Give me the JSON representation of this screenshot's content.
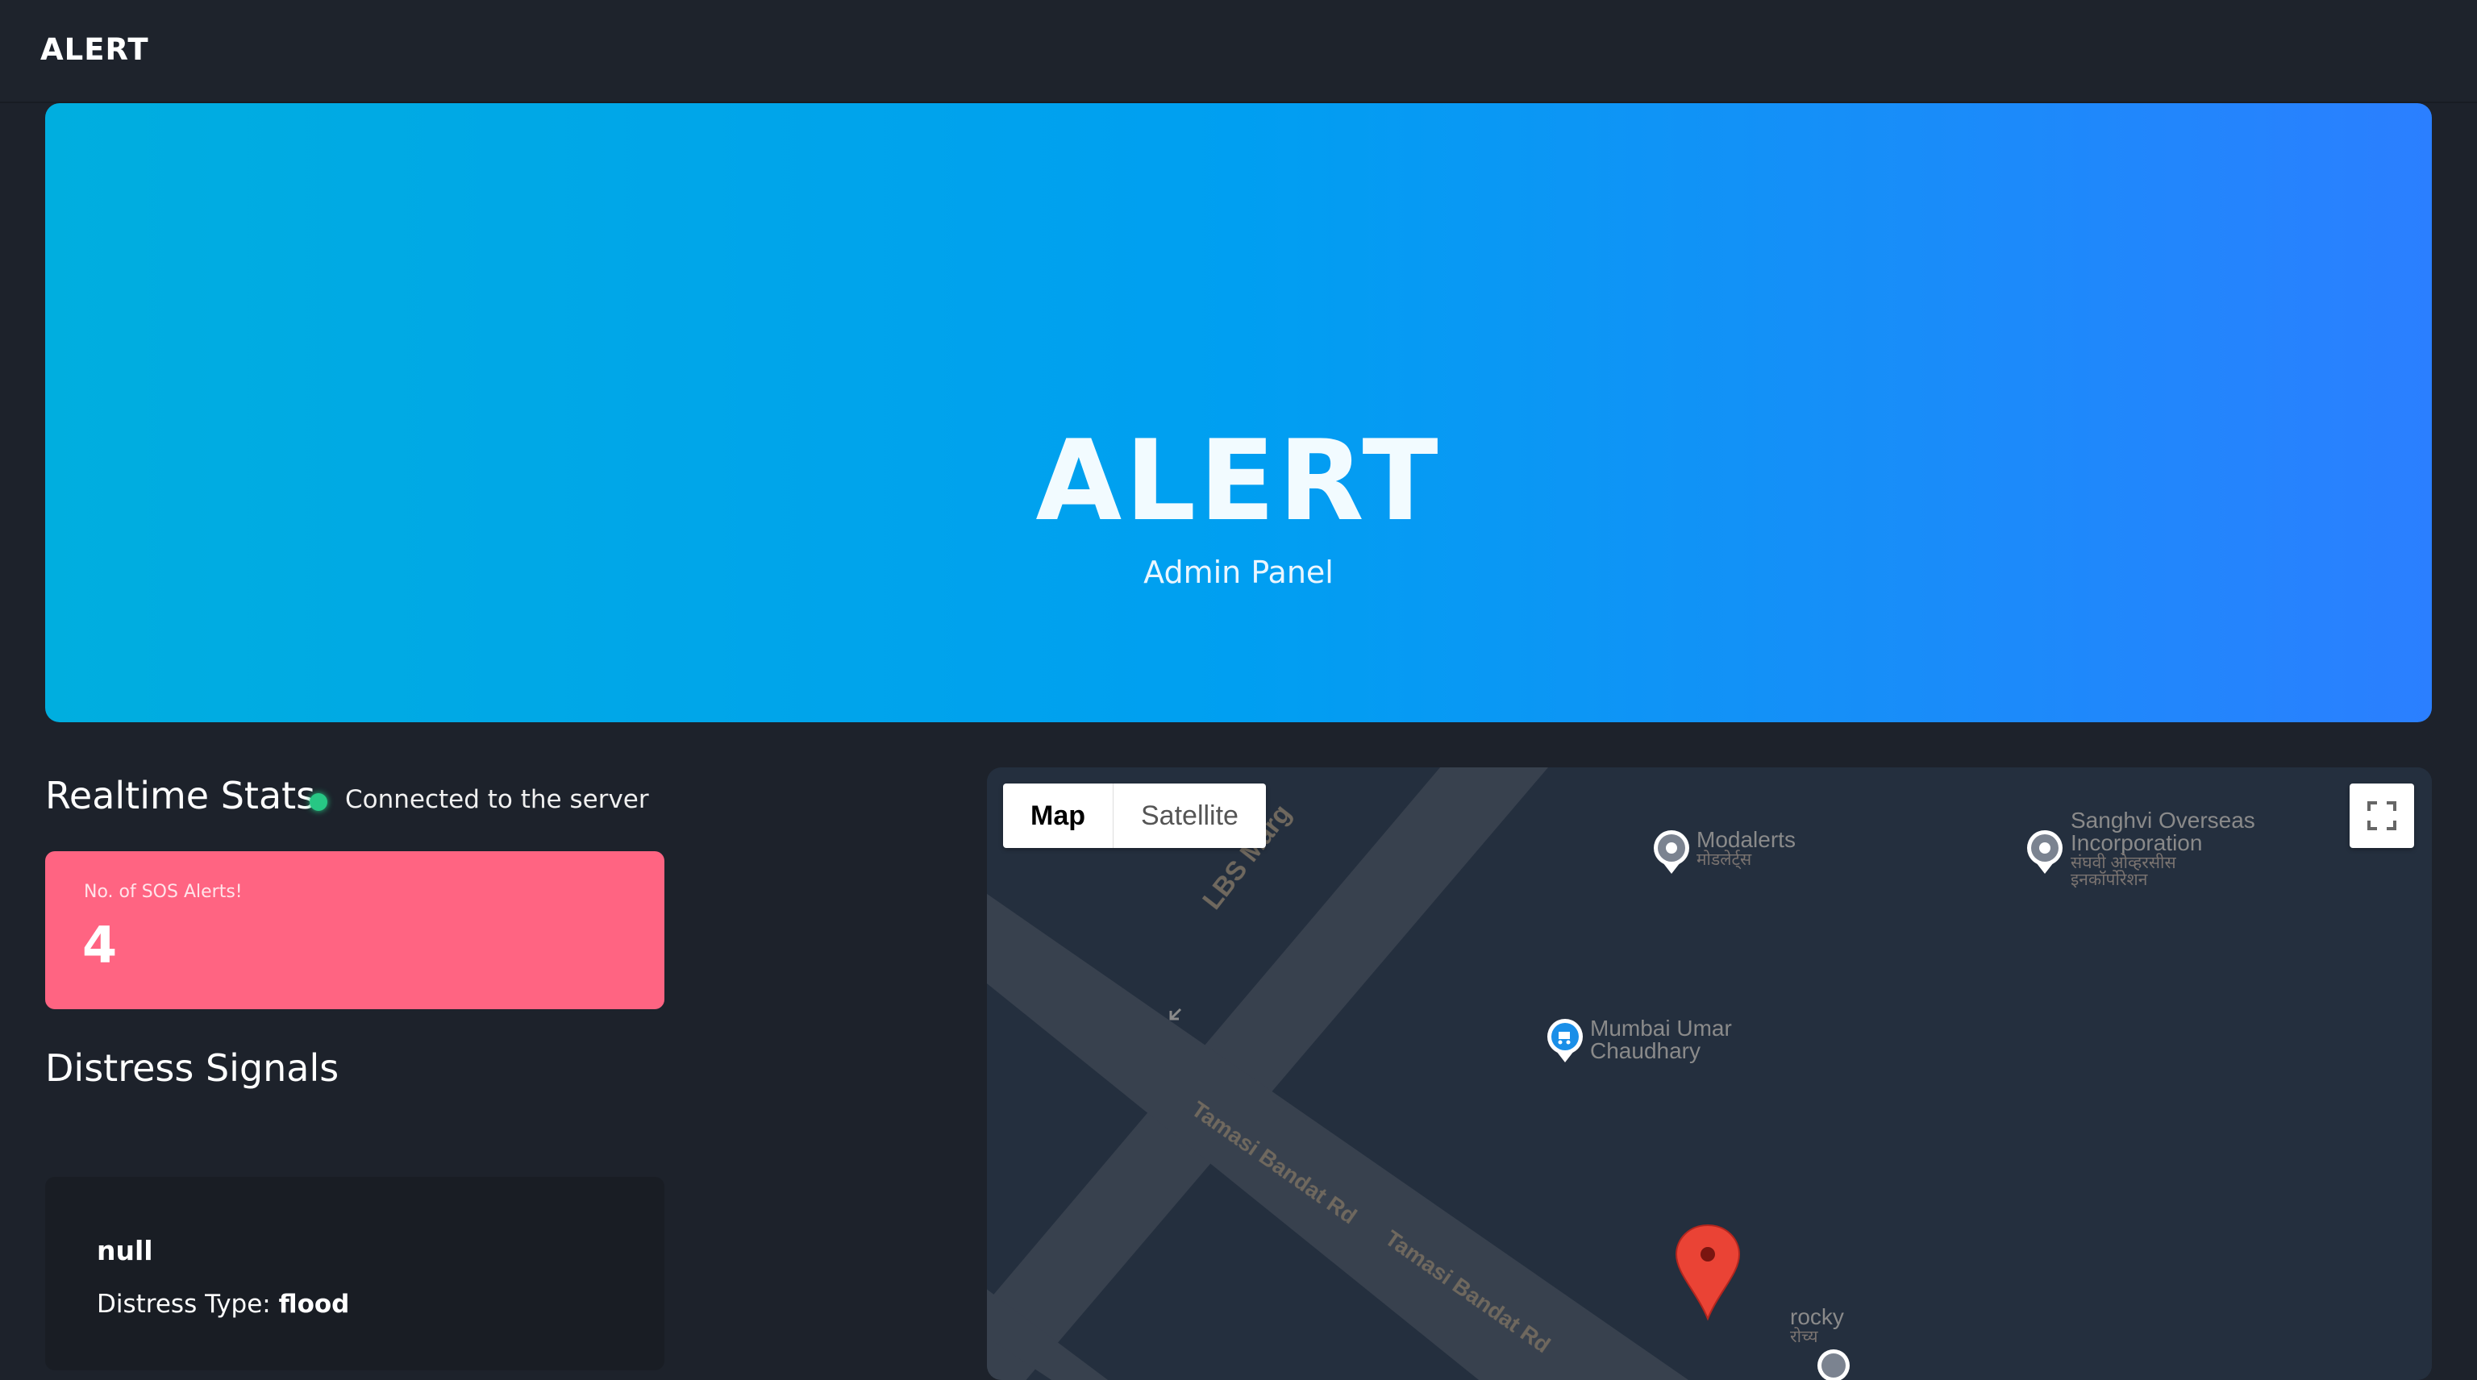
{
  "navbar": {
    "brand": "ALERT"
  },
  "hero": {
    "title": "ALERT",
    "subtitle": "Admin Panel"
  },
  "stats": {
    "title": "Realtime Stats",
    "status_text": "Connected to the server",
    "status_color": "#27c784",
    "sos_card": {
      "label": "No. of SOS Alerts!",
      "value": "4",
      "color": "#ff6482"
    }
  },
  "distress": {
    "title": "Distress Signals",
    "signals": [
      {
        "name": "null",
        "type_label": "Distress Type:",
        "type_value": "flood"
      }
    ]
  },
  "map": {
    "map_type": {
      "map": "Map",
      "satellite": "Satellite",
      "selected": "Map"
    },
    "roads": {
      "lbs": "LBS Marg",
      "tamasi_1": "Tamasi Bandat Rd",
      "tamasi_2": "Tamasi Bandat Rd"
    },
    "pois": {
      "modalerts": {
        "name": "Modalerts",
        "local": "मोडलेर्ट्स"
      },
      "sanghvi": {
        "name_line1": "Sanghvi Overseas",
        "name_line2": "Incorporation",
        "local_line1": "संघवी ओव्हरसीस",
        "local_line2": "इनकॉर्पोरेशन"
      },
      "mumbai_umar": {
        "name_line1": "Mumbai Umar",
        "name_line2": "Chaudhary"
      },
      "rocky": {
        "name": "rocky",
        "local": "रोच्य"
      }
    },
    "icons": [
      "fullscreen-icon",
      "location-pin-icon",
      "shopping-cart-icon",
      "red-marker-icon",
      "arrow-icon"
    ]
  }
}
